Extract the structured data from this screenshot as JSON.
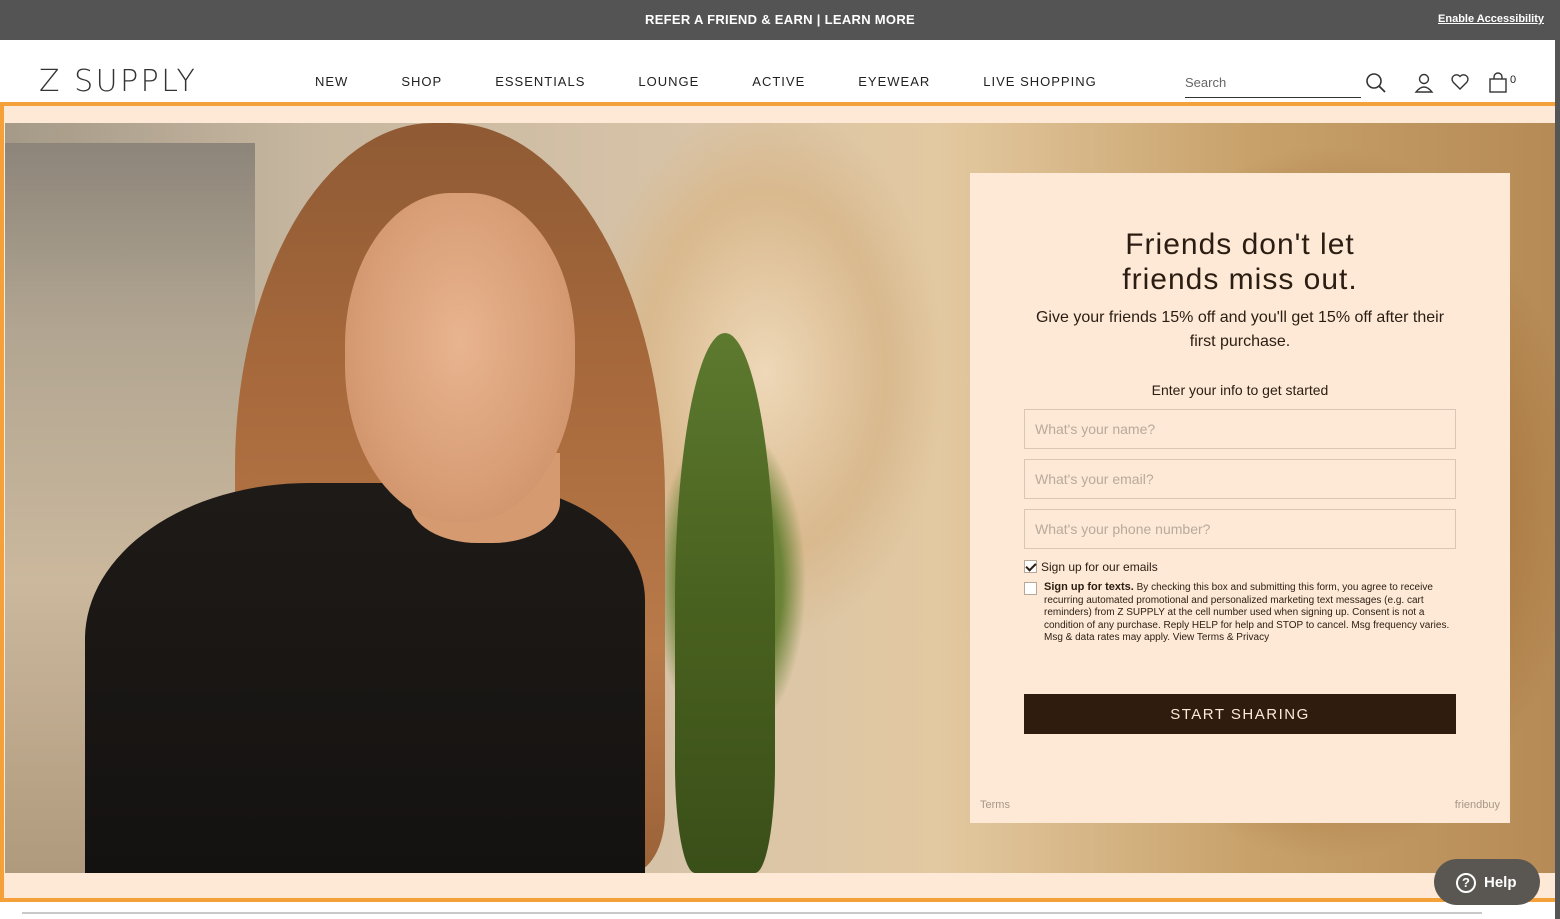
{
  "promo": {
    "text": "REFER A FRIEND & EARN | LEARN MORE",
    "accessibility": "Enable Accessibility"
  },
  "header": {
    "logo": "Z SUPPLY",
    "nav": [
      "NEW",
      "SHOP",
      "ESSENTIALS",
      "LOUNGE",
      "ACTIVE",
      "EYEWEAR",
      "LIVE SHOPPING"
    ],
    "search_placeholder": "Search",
    "cart_count": "0",
    "icons": [
      "search-icon",
      "account-icon",
      "wishlist-heart-icon",
      "shopping-bag-icon"
    ]
  },
  "modal": {
    "heading_line1": "Friends don't let",
    "heading_line2": "friends miss out.",
    "subheading": "Give your friends 15% off and you'll get 15% off after their first purchase.",
    "prompt": "Enter your info to get started",
    "name_placeholder": "What's your name?",
    "email_placeholder": "What's your email?",
    "phone_placeholder": "What's your phone number?",
    "email_optin_label": "Sign up for our emails",
    "email_optin_checked": true,
    "texts_optin_title": "Sign up for texts.",
    "texts_optin_body": "By checking this box and submitting this form, you agree to receive recurring automated promotional and personalized marketing text messages (e.g. cart reminders) from Z SUPPLY at the cell number used when signing up. Consent is not a condition of any purchase. Reply HELP for help and STOP to cancel. Msg frequency varies. Msg & data rates may apply. View Terms & Privacy",
    "texts_optin_checked": false,
    "button_label": "START SHARING",
    "terms_label": "Terms",
    "powered_label": "friendbuy"
  },
  "help": {
    "label": "Help",
    "icon_glyph": "?"
  },
  "colors": {
    "accent_frame": "#f5a13a",
    "modal_bg": "#fde9d6",
    "button_bg": "#2f1c0e"
  }
}
